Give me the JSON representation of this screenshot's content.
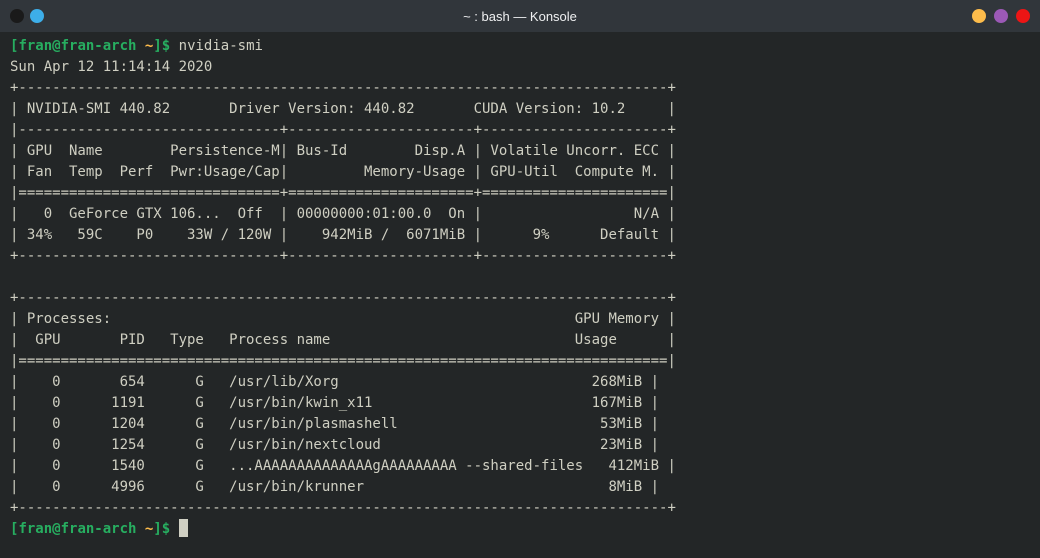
{
  "titlebar": {
    "title": "~ : bash — Konsole"
  },
  "prompt": {
    "user": "fran",
    "host": "fran-arch",
    "path": "~",
    "symbol": "$"
  },
  "command": "nvidia-smi",
  "output": {
    "timestamp": "Sun Apr 12 11:14:14 2020",
    "header_border_top": "+-----------------------------------------------------------------------------+",
    "header_line": "| NVIDIA-SMI 440.82       Driver Version: 440.82       CUDA Version: 10.2     |",
    "section_border": "|-------------------------------+----------------------+----------------------+",
    "col_headers_1": "| GPU  Name        Persistence-M| Bus-Id        Disp.A | Volatile Uncorr. ECC |",
    "col_headers_2": "| Fan  Temp  Perf  Pwr:Usage/Cap|         Memory-Usage | GPU-Util  Compute M. |",
    "eq_border": "|===============================+======================+======================|",
    "gpu_row_1": "|   0  GeForce GTX 106...  Off  | 00000000:01:00.0  On |                  N/A |",
    "gpu_row_2": "| 34%   59C    P0    33W / 120W |    942MiB /  6071MiB |      9%      Default |",
    "bottom_border": "+-------------------------------+----------------------+----------------------+",
    "blank": "                                                                               ",
    "proc_border_top": "+-----------------------------------------------------------------------------+",
    "proc_header_1": "| Processes:                                                       GPU Memory |",
    "proc_header_2": "|  GPU       PID   Type   Process name                             Usage      |",
    "proc_eq_border": "|=============================================================================|",
    "proc_row_1": "|    0       654      G   /usr/lib/Xorg                              268MiB |",
    "proc_row_2": "|    0      1191      G   /usr/bin/kwin_x11                          167MiB |",
    "proc_row_3": "|    0      1204      G   /usr/bin/plasmashell                        53MiB |",
    "proc_row_4": "|    0      1254      G   /usr/bin/nextcloud                          23MiB |",
    "proc_row_5": "|    0      1540      G   ...AAAAAAAAAAAAAAgAAAAAAAAA --shared-files   412MiB |",
    "proc_row_6": "|    0      4996      G   /usr/bin/krunner                             8MiB |",
    "proc_border_bottom": "+-----------------------------------------------------------------------------+"
  }
}
